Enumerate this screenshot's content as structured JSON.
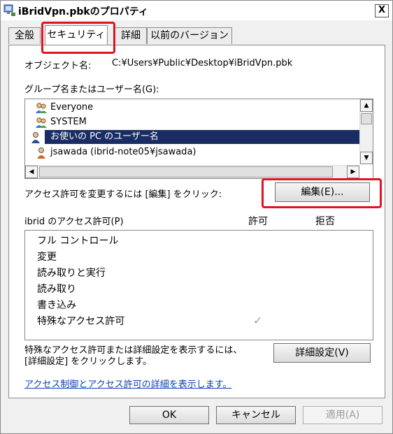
{
  "window": {
    "title": "iBridVpn.pbkのプロパティ",
    "close_label": "X"
  },
  "tabs": [
    {
      "label": "全般"
    },
    {
      "label": "セキュリティ",
      "active": true
    },
    {
      "label": "詳細"
    },
    {
      "label": "以前のバージョン"
    }
  ],
  "security": {
    "object_label": "オブジェクト名:",
    "object_path": "C:¥Users¥Public¥Desktop¥iBridVpn.pbk",
    "groups_label": "グループ名またはユーザー名(G):",
    "groups": [
      {
        "name": "Everyone",
        "icon": "group-icon"
      },
      {
        "name": "SYSTEM",
        "icon": "group-icon"
      },
      {
        "name": "お使いの PC のユーザー名",
        "icon": "user-icon",
        "selected": true
      },
      {
        "name": "jsawada (ibrid-note05¥jsawada)",
        "icon": "user-icon"
      }
    ],
    "change_hint": "アクセス許可を変更するには [編集] をクリック:",
    "edit_button": "編集(E)...",
    "perm_header": "ibrid のアクセス許可(P)",
    "allow_header": "許可",
    "deny_header": "拒否",
    "permissions": [
      {
        "name": "フル コントロール"
      },
      {
        "name": "変更"
      },
      {
        "name": "読み取りと実行"
      },
      {
        "name": "読み取り"
      },
      {
        "name": "書き込み"
      },
      {
        "name": "特殊なアクセス許可",
        "allow_check": "✓"
      }
    ],
    "advanced_hint_line1": "特殊なアクセス許可または詳細設定を表示するには、",
    "advanced_hint_line2": "[詳細設定] をクリックします。",
    "advanced_button": "詳細設定(V)",
    "link_text": "アクセス制御とアクセス許可の詳細を表示します。"
  },
  "footer": {
    "ok": "OK",
    "cancel": "キャンセル",
    "apply": "適用(A)"
  },
  "colors": {
    "highlight": "#e0141e",
    "selection": "#1a2d63",
    "link": "#0f3fb5"
  }
}
